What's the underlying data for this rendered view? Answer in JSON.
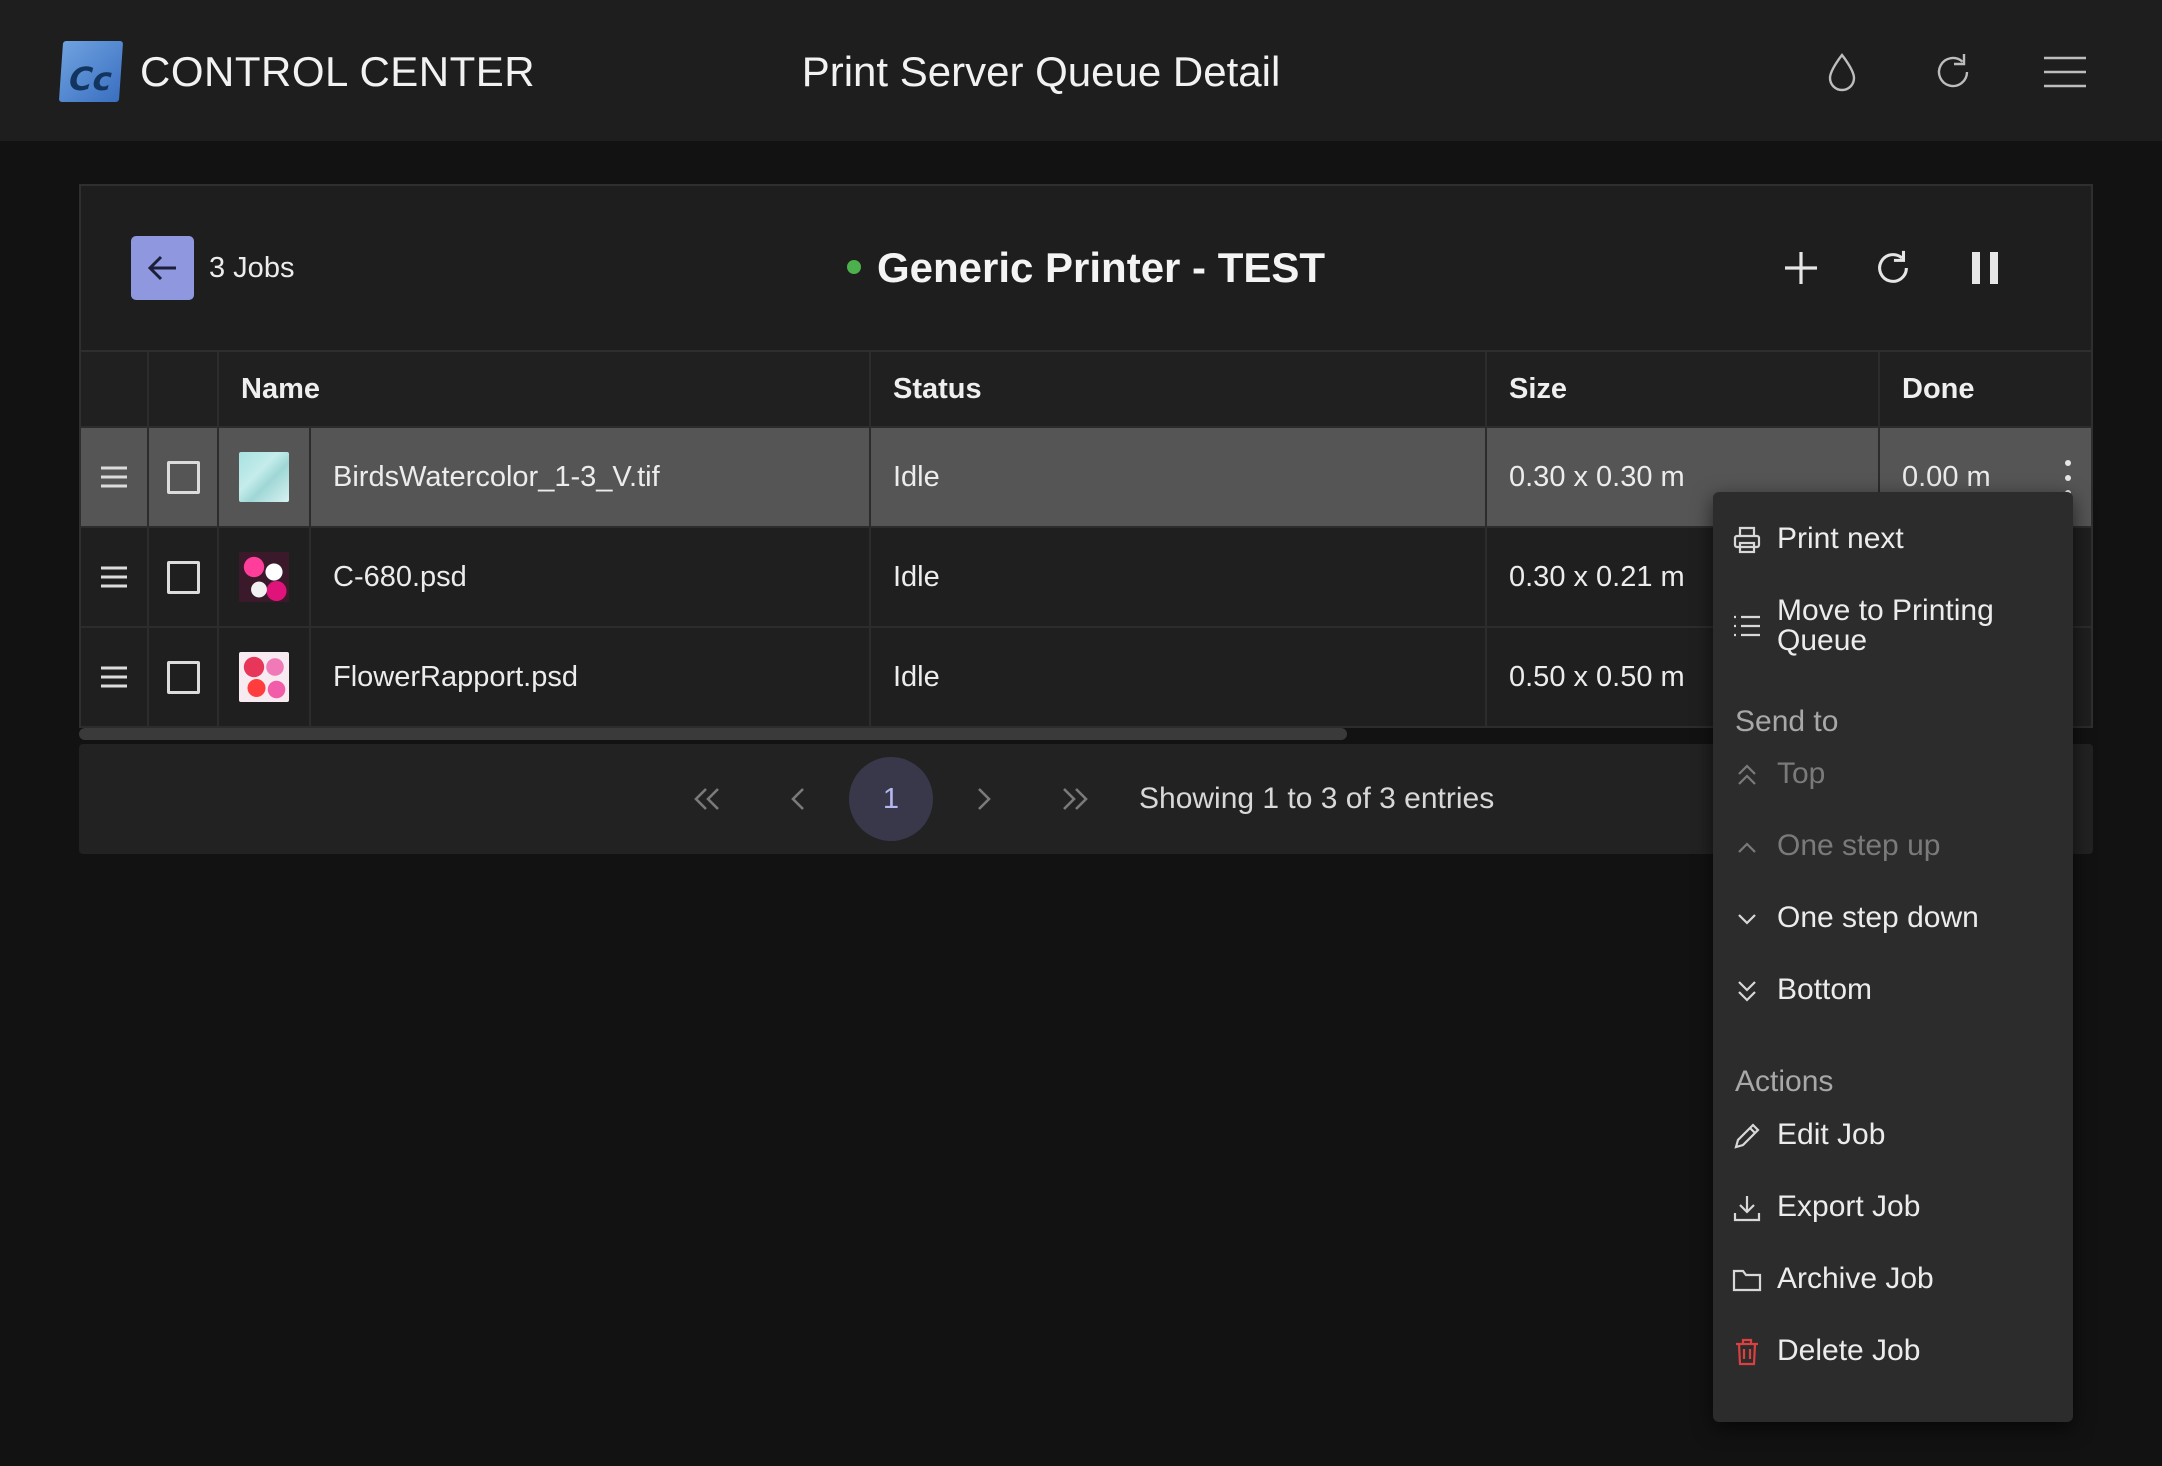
{
  "header": {
    "logo_text": "Cc",
    "brand": "CONTROL CENTER",
    "title": "Print Server Queue Detail",
    "icons": [
      "droplet-icon",
      "refresh-icon",
      "menu-icon"
    ]
  },
  "queue": {
    "jobs_count": "3 Jobs",
    "printer_name": "Generic Printer - TEST",
    "status_color": "#4cb04c",
    "toolbar_icons": [
      "plus-icon",
      "refresh-icon",
      "pause-icon"
    ]
  },
  "table": {
    "columns": [
      "Name",
      "Status",
      "Size",
      "Done"
    ],
    "rows": [
      {
        "name": "BirdsWatercolor_1-3_V.tif",
        "status": "Idle",
        "size": "0.30 x 0.30 m",
        "done": "0.00 m",
        "selected": true
      },
      {
        "name": "C-680.psd",
        "status": "Idle",
        "size": "0.30 x 0.21 m",
        "done": "",
        "selected": false
      },
      {
        "name": "FlowerRapport.psd",
        "status": "Idle",
        "size": "0.50 x 0.50 m",
        "done": "",
        "selected": false
      }
    ]
  },
  "pagination": {
    "current_page": "1",
    "info": "Showing 1 to 3 of 3 entries"
  },
  "context_menu": {
    "print_next": "Print next",
    "move_to_printing_line1": "Move to Printing",
    "move_to_printing_line2": "Queue",
    "send_to_header": "Send to",
    "top": "Top",
    "one_step_up": "One step up",
    "one_step_down": "One step down",
    "bottom": "Bottom",
    "actions_header": "Actions",
    "edit_job": "Edit Job",
    "export_job": "Export Job",
    "archive_job": "Archive Job",
    "delete_job": "Delete Job"
  },
  "colors": {
    "accent": "#8f97de",
    "danger": "#d94040",
    "selected_row": "#555555"
  }
}
